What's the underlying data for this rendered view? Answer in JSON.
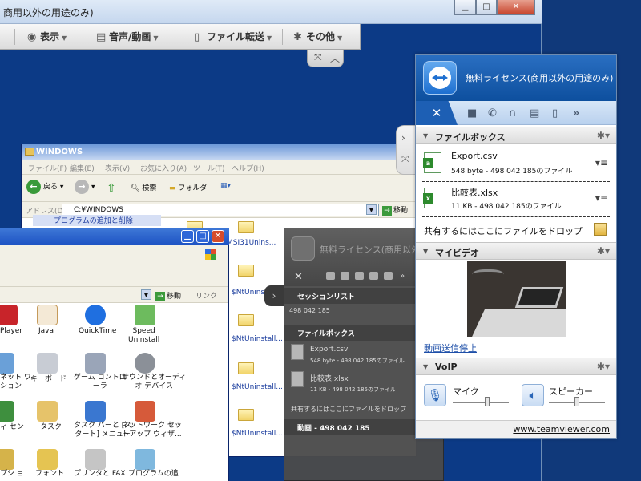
{
  "viewer": {
    "title": "商用以外の用途のみ)",
    "toolbar": [
      {
        "icon": "eye-icon",
        "label": "表示"
      },
      {
        "icon": "chat-icon",
        "label": "音声/動画"
      },
      {
        "icon": "file-icon",
        "label": "ファイル転送"
      },
      {
        "icon": "gear-icon",
        "label": "その他"
      }
    ]
  },
  "windows_explorer": {
    "title": "WINDOWS",
    "menu": [
      "ファイル(F)",
      "編集(E)",
      "表示(V)",
      "お気に入り(A)",
      "ツール(T)",
      "ヘルプ(H)"
    ],
    "toolbar": {
      "back": "戻る",
      "search": "検索",
      "folder": "フォルダ"
    },
    "address_label": "アドレス(D)",
    "address_value": "C:¥WINDOWS",
    "go": "移動",
    "sidebar_item": "プログラムの追加と削除",
    "folders": [
      "MSI31Unins...",
      "$NtUninstall...",
      "$NtUninstall...",
      "$NtUninstall...",
      "$NtUninstall..."
    ]
  },
  "control_panel": {
    "go": "移動",
    "link": "リンク",
    "icons": [
      {
        "label": "Player"
      },
      {
        "label": "Java"
      },
      {
        "label": "QuickTime"
      },
      {
        "label": "Speed\nUninstall"
      },
      {
        "label": "ネット ワ\nション"
      },
      {
        "label": "キーボード"
      },
      {
        "label": "ゲーム コントロ\nーラ"
      },
      {
        "label": "サウンドとオーディ\nオ デバイス"
      },
      {
        "label": "ィ セン"
      },
      {
        "label": "タスク"
      },
      {
        "label": "タスク バーと [ス\nタート] メニュー"
      },
      {
        "label": "ネットワーク セッ\nトアップ ウィザ..."
      },
      {
        "label": "プシ ョ"
      },
      {
        "label": "フォント"
      },
      {
        "label": "プリンタと FAX"
      },
      {
        "label": "プログラムの追"
      }
    ]
  },
  "dark_panel": {
    "license": "無料ライセンス(商用以外の用途のみ)",
    "session_section": "セッションリスト",
    "session_id": "498 042 185",
    "filebox_section": "ファイルボックス",
    "files": [
      {
        "name": "Export.csv",
        "size": "548 byte - 498 042 185のファイル"
      },
      {
        "name": "比較表.xlsx",
        "size": "11 KB - 498 042 185のファイル"
      }
    ],
    "drop_text": "共有するにはここにファイルをドロップ",
    "video_section": "動画 - 498 042 185"
  },
  "teamviewer": {
    "license": "無料ライセンス(商用以外の用途のみ)",
    "toolbar_icons": [
      "camera-icon",
      "phone-icon",
      "headset-icon",
      "chat-icon",
      "copy-icon",
      "more-icon"
    ],
    "sections": {
      "filebox": "ファイルボックス",
      "myvideo": "マイビデオ",
      "voip": "VoIP"
    },
    "files": [
      {
        "name": "Export.csv",
        "size": "548 byte - 498 042 185のファイル"
      },
      {
        "name": "比較表.xlsx",
        "size": "11 KB - 498 042 185のファイル"
      }
    ],
    "drop_text": "共有するにはここにファイルをドロップ",
    "video_stop": "動画送信停止",
    "voip": {
      "mic_label": "マイク",
      "speaker_label": "スピーカー",
      "mic_level": 0.62,
      "speaker_level": 0.5
    },
    "footer_link": "www.teamviewer.com"
  }
}
